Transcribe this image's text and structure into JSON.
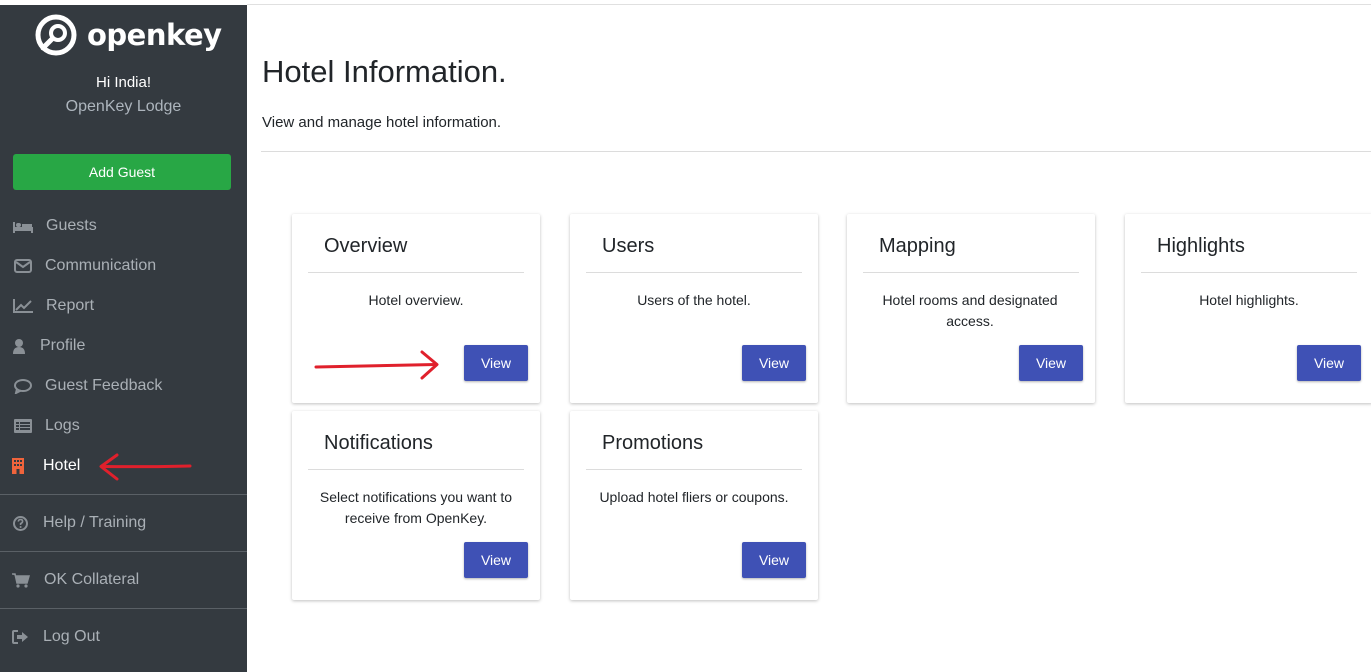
{
  "app": {
    "logo_text": "openkey",
    "greeting": "Hi India!",
    "property": "OpenKey Lodge"
  },
  "sidebar": {
    "add_guest_label": "Add Guest",
    "items": [
      {
        "label": "Guests",
        "icon": "bed-icon"
      },
      {
        "label": "Communication",
        "icon": "envelope-icon"
      },
      {
        "label": "Report",
        "icon": "chart-line-icon"
      },
      {
        "label": "Profile",
        "icon": "user-icon"
      },
      {
        "label": "Guest Feedback",
        "icon": "comment-icon"
      },
      {
        "label": "Logs",
        "icon": "list-icon"
      },
      {
        "label": "Hotel",
        "icon": "building-icon",
        "active": true
      }
    ],
    "help_label": "Help / Training",
    "collateral_label": "OK Collateral",
    "logout_label": "Log Out"
  },
  "main": {
    "title": "Hotel Information.",
    "subtitle": "View and manage hotel information.",
    "cards": [
      {
        "title": "Overview",
        "description": "Hotel overview.",
        "button": "View"
      },
      {
        "title": "Users",
        "description": "Users of the hotel.",
        "button": "View"
      },
      {
        "title": "Mapping",
        "description": "Hotel rooms and designated access.",
        "button": "View"
      },
      {
        "title": "Highlights",
        "description": "Hotel highlights.",
        "button": "View"
      },
      {
        "title": "Notifications",
        "description": "Select notifications you want to receive from OpenKey.",
        "button": "View"
      },
      {
        "title": "Promotions",
        "description": "Upload hotel fliers or coupons.",
        "button": "View"
      }
    ]
  },
  "colors": {
    "sidebar_bg": "#343a40",
    "add_guest_green": "#28a745",
    "view_button_blue": "#3f51b5",
    "active_icon_orange": "#f0643c",
    "annotation_red": "#e0202c"
  }
}
